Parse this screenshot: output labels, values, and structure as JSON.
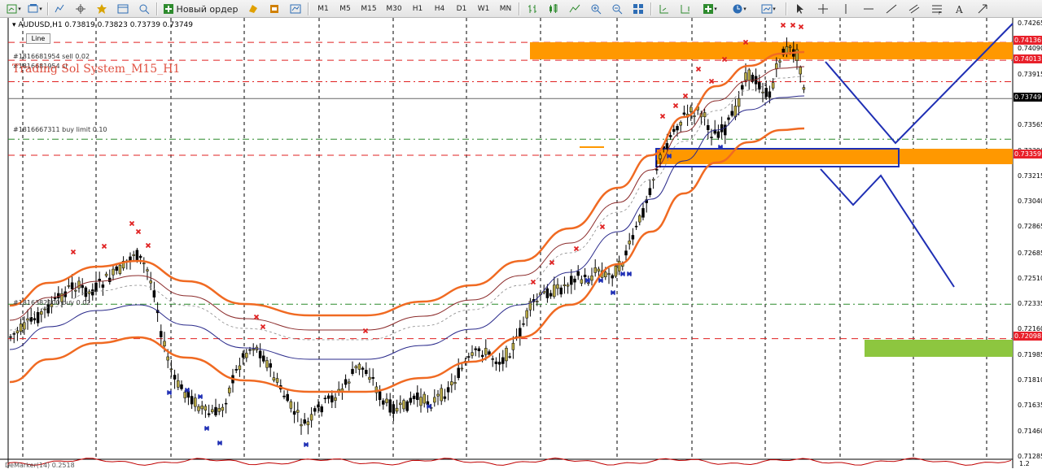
{
  "toolbar": {
    "new_order_label": "Новый ордер",
    "timeframes": [
      "M1",
      "M5",
      "M15",
      "M30",
      "H1",
      "H4",
      "D1",
      "W1",
      "MN"
    ],
    "icons": [
      "new-chart-icon",
      "profiles-icon",
      "market-watch-icon",
      "navigator-icon",
      "favorites-icon",
      "terminal-icon",
      "strategy-tester-icon",
      "new-order-icon",
      "metaeditor-icon",
      "autotrading-icon",
      "history-icon",
      "bar-chart-icon",
      "candlestick-icon",
      "line-chart-icon",
      "zoom-in-icon",
      "zoom-out-icon",
      "tile-windows-icon",
      "auto-scroll-icon",
      "chart-shift-icon",
      "indicators-icon",
      "periodicity-icon",
      "templates-icon",
      "cursor-icon",
      "crosshair-icon",
      "vertical-line-icon",
      "horizontal-line-icon",
      "trendline-icon",
      "equidistant-channel-icon",
      "fibonacci-icon",
      "text-icon",
      "arrows-icon"
    ]
  },
  "chart": {
    "symbol": "AUDUSD,H1",
    "ohlc": "0.73819 0.73823 0.73739 0.73749",
    "line_button": "Line",
    "system_label": "Trading Sol System_M15_H1",
    "order_labels": {
      "sell": "#1816681954 sell 0.02",
      "sell2": "#1816681954 sl",
      "buy_limit": "#1816667311 buy limit 0.10",
      "other": "#1816382100 buy 0.02"
    },
    "price_axis": [
      "0.74265",
      "0.74090",
      "0.73915",
      "0.73565",
      "0.73390",
      "0.73215",
      "0.73040",
      "0.72865",
      "0.72685",
      "0.72510",
      "0.72335",
      "0.72160",
      "0.71985",
      "0.71810",
      "0.71635",
      "0.71460",
      "0.71285"
    ],
    "price_tags": {
      "current": "0.73749",
      "top": "0.74136",
      "upper": "0.74013",
      "mid": "0.73359",
      "low": "0.72098"
    },
    "bottom_label": "DeMarker(14) 0.2518",
    "bottom_tick": "1.2",
    "colors": {
      "up_candle": "#b5a642",
      "down_candle": "#000000",
      "band": "#f06a22",
      "zone_orange": "#ff9800",
      "zone_green": "#8dc63f",
      "forecast": "#1f2fb4",
      "sell_marker": "#e02020",
      "buy_marker": "#1f2fb4",
      "level_red": "#e02020",
      "level_green": "#2a8a2a"
    }
  }
}
